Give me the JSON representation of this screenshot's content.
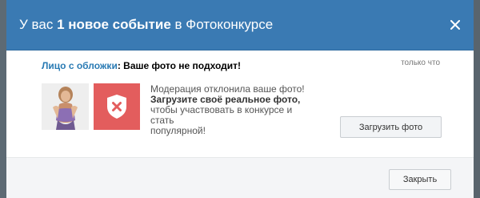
{
  "modal": {
    "title_prefix": "У вас",
    "title_highlight": "1 новое событие",
    "title_suffix": "в Фотоконкурсе"
  },
  "notification": {
    "contest_name": "Лицо с обложки",
    "colon": ":",
    "message": "Ваше фото не подходит!",
    "timestamp": "только что",
    "moderation_line1": "Модерация отклонила ваше фото!",
    "moderation_line2": "Загрузите своё реальное фото,",
    "moderation_line3": "чтобы участвовать в конкурсе и стать",
    "moderation_line4": "популярной!"
  },
  "buttons": {
    "upload_label": "Загрузить фото",
    "close_label": "Закрыть"
  },
  "icons": {
    "close": "close-icon",
    "reject": "shield-x-icon"
  },
  "colors": {
    "header_bg": "#3a7ab3",
    "link": "#2a7bb4",
    "reject_bg": "#e35d5d"
  }
}
